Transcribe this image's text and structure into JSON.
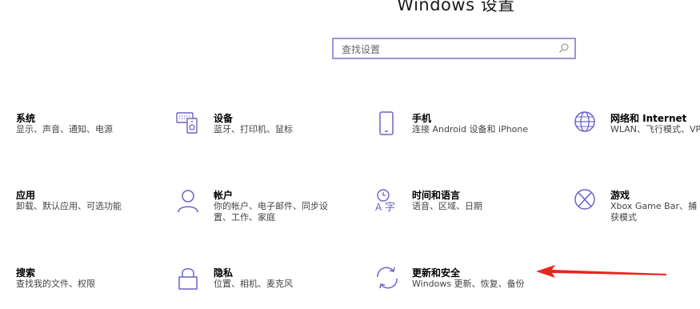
{
  "window": {
    "title": "Windows 设置"
  },
  "search": {
    "placeholder": "查找设置",
    "icon": "search-icon"
  },
  "tiles": [
    {
      "name": "系统",
      "desc": "显示、声音、通知、电源",
      "icon": "system-icon"
    },
    {
      "name": "设备",
      "desc": "蓝牙、打印机、鼠标",
      "icon": "devices-icon"
    },
    {
      "name": "手机",
      "desc": "连接 Android 设备和 iPhone",
      "icon": "phone-icon"
    },
    {
      "name": "网络和 Internet",
      "desc": "WLAN、飞行模式、VP",
      "icon": "globe-icon"
    },
    {
      "name": "应用",
      "desc": "卸载、默认应用、可选功能",
      "icon": "apps-icon"
    },
    {
      "name": "帐户",
      "desc": "你的帐户、电子邮件、同步设置、工作、家庭",
      "icon": "person-icon"
    },
    {
      "name": "时间和语言",
      "desc": "语音、区域、日期",
      "icon": "time-language-icon"
    },
    {
      "name": "游戏",
      "desc": "Xbox Game Bar、捕获模式",
      "icon": "xbox-icon"
    },
    {
      "name": "搜索",
      "desc": "查找我的文件、权限",
      "icon": "search-tile-icon"
    },
    {
      "name": "隐私",
      "desc": "位置、相机、麦克风",
      "icon": "lock-icon"
    },
    {
      "name": "更新和安全",
      "desc": "Windows 更新、恢复、备份",
      "icon": "update-icon"
    }
  ],
  "colors": {
    "accent": "#9b95d6",
    "icon": "#6b63c7",
    "arrow": "#e8251f"
  }
}
